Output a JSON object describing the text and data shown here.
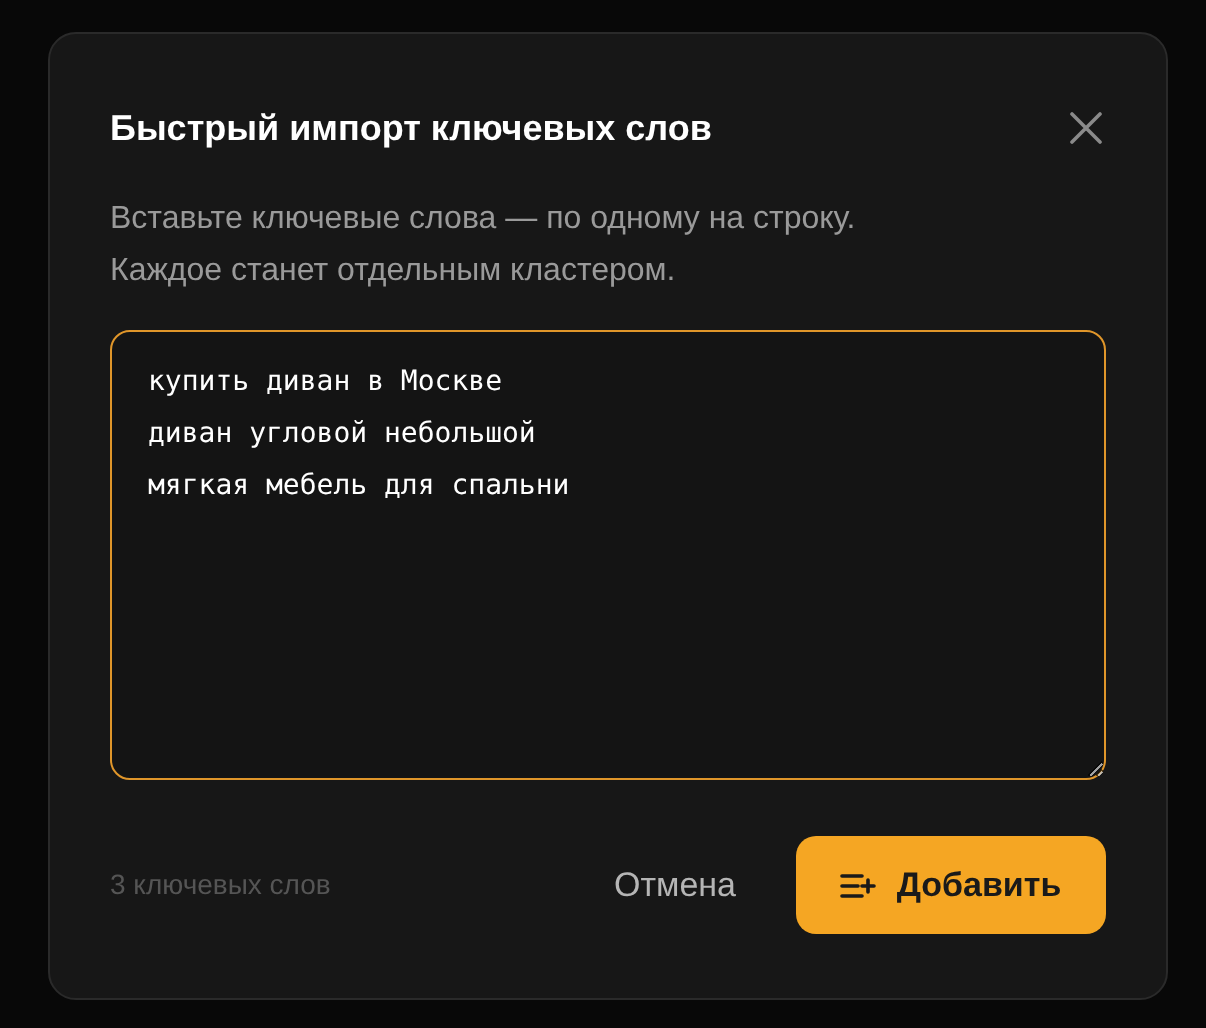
{
  "dialog": {
    "title": "Быстрый импорт ключевых слов",
    "description": "Вставьте ключевые слова — по одному на строку.\nКаждое станет отдельным кластером.",
    "textarea": {
      "value": "купить диван в Москве\nдиван угловой небольшой\nмягкая мебель для спальни",
      "focused": true
    },
    "count": "3 ключевых слов",
    "cancel": "Отмена",
    "submit": "Добавить"
  }
}
